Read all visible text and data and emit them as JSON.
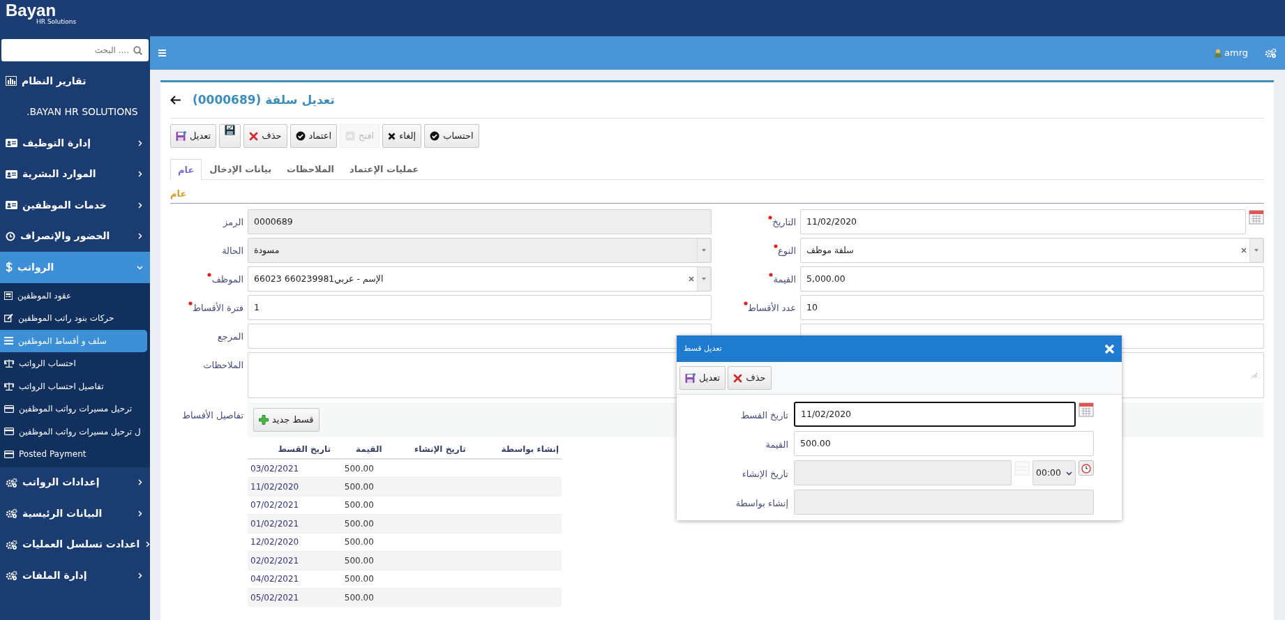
{
  "brand": {
    "logo": "Bayan",
    "tagline": "HR Solutions"
  },
  "sidebar": {
    "search_placeholder": ".... البحث",
    "items": [
      {
        "label": "تقارير النظام",
        "kind": "reports",
        "expandable": false,
        "expanded": false
      },
      {
        "label": "BAYAN HR SOLUTIONS.",
        "kind": "heading",
        "expandable": false,
        "expanded": false
      },
      {
        "label": "إدارة التوظيف",
        "kind": "module",
        "expandable": true,
        "expanded": false
      },
      {
        "label": "الموارد البشرية",
        "kind": "module",
        "expandable": true,
        "expanded": false
      },
      {
        "label": "خدمات الموظفين",
        "kind": "module",
        "expandable": true,
        "expanded": false
      },
      {
        "label": "الحضور والإنصراف",
        "kind": "attendance",
        "expandable": true,
        "expanded": false
      },
      {
        "label": "الرواتب",
        "kind": "payroll",
        "expandable": true,
        "expanded": true,
        "children": [
          {
            "label": "عقود الموظفين",
            "kind": "contracts",
            "selected": false
          },
          {
            "label": "حركات بنود راتب الموظفين",
            "kind": "transactions",
            "selected": false
          },
          {
            "label": "سلف و أقساط الموظفين",
            "kind": "loans",
            "selected": true
          },
          {
            "label": "احتساب الرواتب",
            "kind": "calculation",
            "selected": false
          },
          {
            "label": "تفاصيل احتساب الرواتب",
            "kind": "calculation",
            "selected": false
          },
          {
            "label": "ترحيل مسيرات رواتب الموظفين",
            "kind": "posting",
            "selected": false
          },
          {
            "label": "ل ترحيل مسيرات رواتب الموظفين",
            "kind": "posting",
            "selected": false
          },
          {
            "label": "Posted Payment",
            "kind": "posting",
            "selected": false
          }
        ]
      },
      {
        "label": "إعدادات الرواتب",
        "kind": "settings",
        "expandable": true,
        "expanded": false
      },
      {
        "label": "البيانات الرئيسية",
        "kind": "settings",
        "expandable": true,
        "expanded": false
      },
      {
        "label": "اعدادت تسلسل العمليات",
        "kind": "settings",
        "expandable": true,
        "expanded": false
      },
      {
        "label": "إدارة الملفات",
        "kind": "settings",
        "expandable": true,
        "expanded": false
      }
    ]
  },
  "header": {
    "user": "amrg"
  },
  "page": {
    "title": "تعديل سلفة (0000689)",
    "toolbar": [
      {
        "label": "احتساب",
        "kind": "calculate",
        "disabled": false
      },
      {
        "label": "إلغاء",
        "kind": "cancel",
        "disabled": false
      },
      {
        "label": "افتح",
        "kind": "open",
        "disabled": true
      },
      {
        "label": "اعتماد",
        "kind": "approve",
        "disabled": false
      },
      {
        "label": "حذف",
        "kind": "delete",
        "disabled": false
      },
      {
        "kind": "save",
        "disabled": false
      },
      {
        "label": "تعديل",
        "kind": "edit",
        "disabled": false
      }
    ],
    "tabs": [
      {
        "label": "عمليات الإعتماد",
        "selected": false
      },
      {
        "label": "الملاحظات",
        "selected": false
      },
      {
        "label": "بيانات الإدخال",
        "selected": false
      },
      {
        "label": "عام",
        "selected": true
      }
    ],
    "section_title": "عام",
    "form_rows": [
      {
        "right": {
          "label": "التاريخ",
          "kind": "date",
          "value": "11/02/2020",
          "required": true,
          "disabled": false
        },
        "left": {
          "label": "الرمز",
          "kind": "text",
          "value": "0000689",
          "required": false,
          "disabled": true
        }
      },
      {
        "right": {
          "label": "النوع",
          "kind": "select",
          "value": "سلفة موظف",
          "required": true,
          "disabled": false
        },
        "left": {
          "label": "الحالة",
          "kind": "select",
          "value": "مسودة",
          "required": false,
          "disabled": true
        }
      },
      {
        "right": {
          "label": "القيمة",
          "kind": "text",
          "value": "5,000.00",
          "required": true,
          "disabled": false
        },
        "left": {
          "label": "الموظف",
          "kind": "select",
          "value": "الإسم - عربي660239981 66023",
          "required": true,
          "disabled": false
        }
      },
      {
        "right": {
          "label": "عدد الأقساط",
          "kind": "text",
          "value": "10",
          "required": true,
          "disabled": false
        },
        "left": {
          "label": "فترة الأقساط",
          "kind": "text",
          "value": "1",
          "required": true,
          "disabled": false
        }
      },
      {
        "right": {
          "kind": "text",
          "disabled": false
        },
        "left": {
          "label": "المرجع",
          "kind": "text",
          "required": false,
          "disabled": false
        }
      },
      {
        "right": {
          "kind": "textarea",
          "disabled": false
        },
        "left": {
          "label": "الملاحظات",
          "kind": "textarea",
          "required": false,
          "disabled": false
        }
      }
    ],
    "installments": {
      "label": "تفاصيل الأقساط",
      "new_button": "قسط جديد",
      "columns": [
        "إنشاء بواسطة",
        "تاريخ الإنشاء",
        "القيمة",
        "تاريخ القسط"
      ],
      "rows": [
        {
          "amount": "500.00",
          "installment_date": "03/02/2021"
        },
        {
          "amount": "500.00",
          "installment_date": "11/02/2020"
        },
        {
          "amount": "500.00",
          "installment_date": "07/02/2021"
        },
        {
          "amount": "500.00",
          "installment_date": "01/02/2021"
        },
        {
          "amount": "500.00",
          "installment_date": "12/02/2020"
        },
        {
          "amount": "500.00",
          "installment_date": "02/02/2021"
        },
        {
          "amount": "500.00",
          "installment_date": "04/02/2021"
        },
        {
          "amount": "500.00",
          "installment_date": "05/02/2021"
        }
      ]
    }
  },
  "dialog": {
    "title": "تعديل قسط",
    "buttons": [
      {
        "label": "حذف",
        "kind": "delete"
      },
      {
        "label": "تعديل",
        "kind": "edit"
      }
    ],
    "fields": [
      {
        "label": "تاريخ القسط",
        "kind": "date",
        "value": "11/02/2020",
        "disabled": false,
        "focused": true
      },
      {
        "label": "القيمة",
        "kind": "text",
        "value": "500.00",
        "disabled": false,
        "focused": false
      },
      {
        "label": "تاريخ الإنشاء",
        "kind": "datetime",
        "time": "00:00",
        "disabled": true,
        "focused": false
      },
      {
        "label": "إنشاء بواسطة",
        "kind": "text",
        "disabled": true,
        "focused": false
      }
    ]
  }
}
